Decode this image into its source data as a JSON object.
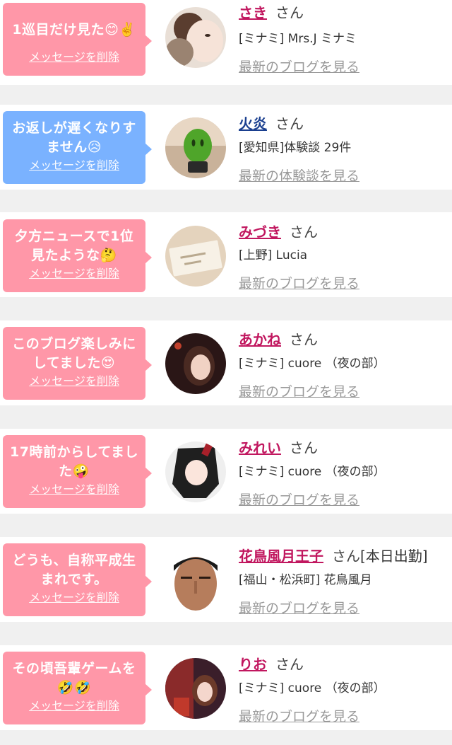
{
  "messages": [
    {
      "text": "1巡目だけ見た😊✌️",
      "delete_label": "メッセージを削除",
      "name": "さき",
      "honorific": "さん",
      "status": "",
      "shop": "[ミナミ] Mrs.J ミナミ",
      "latest_link": "最新のブログを見る",
      "bubble_color": "#ff97a8",
      "name_color": "#c1175f",
      "avatar_icon": "woman-with-dog-photo"
    },
    {
      "text": "お返しが遅くなりすません😥",
      "delete_label": "メッセージを削除",
      "name": "火炎",
      "honorific": "さん",
      "status": "",
      "shop": "[愛知県]体験談 29件",
      "latest_link": "最新の体験談を見る",
      "bubble_color": "#7ab2ff",
      "name_color": "#1a3f8f",
      "avatar_icon": "green-figure-photo"
    },
    {
      "text": "夕方ニュースで1位見たような🤔",
      "delete_label": "メッセージを削除",
      "name": "みづき",
      "honorific": "さん",
      "status": "",
      "shop": "[上野] Lucia",
      "latest_link": "最新のブログを見る",
      "bubble_color": "#ff97a8",
      "name_color": "#c1175f",
      "avatar_icon": "business-card-photo"
    },
    {
      "text": "このブログ楽しみにしてました😍",
      "delete_label": "メッセージを削除",
      "name": "あかね",
      "honorific": "さん",
      "status": "",
      "shop": "[ミナミ] cuore （夜の部）",
      "latest_link": "最新のブログを見る",
      "bubble_color": "#ff97a8",
      "name_color": "#c1175f",
      "avatar_icon": "woman-portrait-photo"
    },
    {
      "text": "17時前からしてました🤪",
      "delete_label": "メッセージを削除",
      "name": "みれい",
      "honorific": "さん",
      "status": "",
      "shop": "[ミナミ] cuore （夜の部）",
      "latest_link": "最新のブログを見る",
      "bubble_color": "#ff97a8",
      "name_color": "#c1175f",
      "avatar_icon": "anime-girl-avatar"
    },
    {
      "text": "どうも、自称平成生まれです。",
      "delete_label": "メッセージを削除",
      "name": "花鳥風月王子",
      "honorific": "さん",
      "status": "[本日出勤]",
      "shop": "[福山・松浜町] 花鳥風月",
      "latest_link": "最新のブログを見る",
      "bubble_color": "#ff97a8",
      "name_color": "#c1175f",
      "avatar_icon": "man-face-photo"
    },
    {
      "text": "その頃吾輩ゲームを🤣🤣",
      "delete_label": "メッセージを削除",
      "name": "りお",
      "honorific": "さん",
      "status": "",
      "shop": "[ミナミ] cuore （夜の部）",
      "latest_link": "最新のブログを見る",
      "bubble_color": "#ff97a8",
      "name_color": "#c1175f",
      "avatar_icon": "woman-selfie-photo"
    }
  ]
}
